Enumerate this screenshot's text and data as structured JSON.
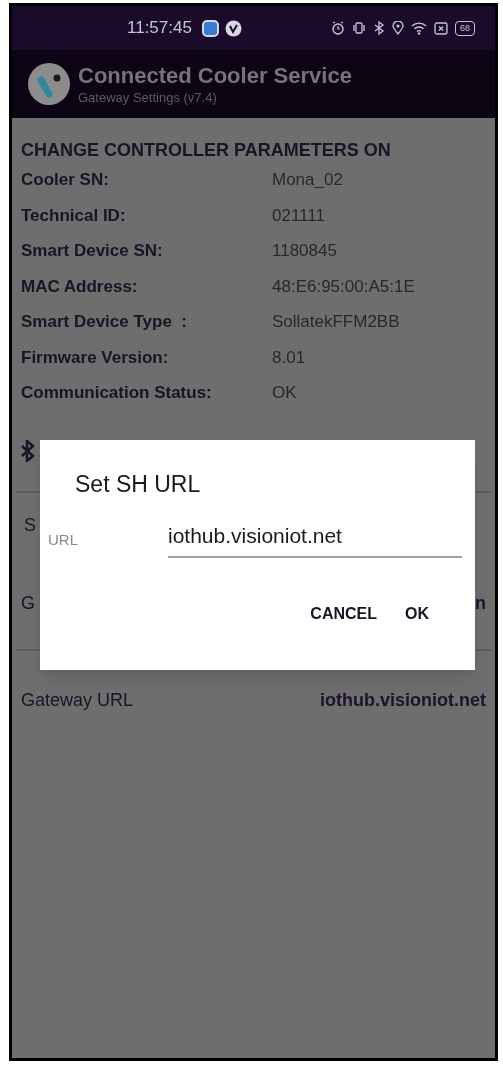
{
  "status_bar": {
    "time": "11:57:45",
    "battery": "68"
  },
  "app_bar": {
    "title": "Connected Cooler Service",
    "subtitle": "Gateway Settings (v7.4)"
  },
  "section_title": "CHANGE CONTROLLER PARAMETERS ON",
  "details": [
    {
      "label": "Cooler SN:",
      "value": "Mona_02"
    },
    {
      "label": "Technical ID:",
      "value": "021111"
    },
    {
      "label": "Smart Device SN:",
      "value": "1180845"
    },
    {
      "label": "MAC Address:",
      "value": "48:E6:95:00:A5:1E"
    },
    {
      "label": "Smart Device Type  :",
      "value": "SollatekFFM2BB"
    },
    {
      "label": "Firmware Version:",
      "value": "8.01"
    },
    {
      "label": "Communication Status:",
      "value": "OK"
    }
  ],
  "settings_rows": [
    {
      "label": "S"
    },
    {
      "label": "G",
      "value": "n"
    },
    {
      "label": "Gateway URL",
      "value": "iothub.visioniot.net"
    }
  ],
  "dialog": {
    "title": "Set SH URL",
    "field_label": "URL",
    "field_value": "iothub.visioniot.net",
    "buttons": [
      "CANCEL",
      "OK"
    ]
  }
}
